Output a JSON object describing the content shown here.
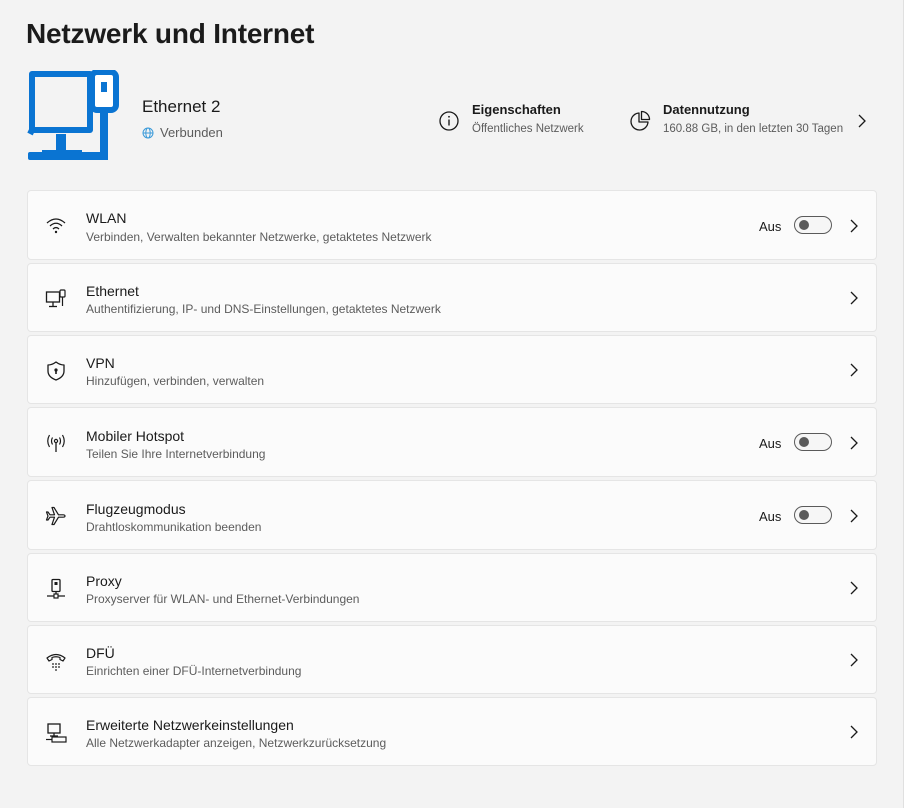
{
  "page": {
    "title": "Netzwerk und Internet"
  },
  "hero": {
    "name": "Ethernet 2",
    "status": "Verbunden",
    "properties": {
      "title": "Eigenschaften",
      "subtitle": "Öffentliches Netzwerk"
    },
    "usage": {
      "title": "Datennutzung",
      "subtitle": "160.88 GB, in den letzten 30 Tagen"
    }
  },
  "items": [
    {
      "title": "WLAN",
      "desc": "Verbinden, Verwalten bekannter Netzwerke, getaktetes Netzwerk",
      "state": "Aus",
      "icon": "wifi-icon"
    },
    {
      "title": "Ethernet",
      "desc": "Authentifizierung, IP- und DNS-Einstellungen, getaktetes Netzwerk",
      "icon": "ethernet-icon"
    },
    {
      "title": "VPN",
      "desc": "Hinzufügen, verbinden, verwalten",
      "icon": "shield-icon"
    },
    {
      "title": "Mobiler Hotspot",
      "desc": "Teilen Sie Ihre Internetverbindung",
      "state": "Aus",
      "icon": "hotspot-icon"
    },
    {
      "title": "Flugzeugmodus",
      "desc": "Drahtloskommunikation beenden",
      "state": "Aus",
      "icon": "airplane-icon"
    },
    {
      "title": "Proxy",
      "desc": "Proxyserver für WLAN- und Ethernet-Verbindungen",
      "icon": "proxy-icon"
    },
    {
      "title": "DFÜ",
      "desc": "Einrichten einer DFÜ-Internetverbindung",
      "icon": "dialup-icon"
    },
    {
      "title": "Erweiterte Netzwerkeinstellungen",
      "desc": "Alle Netzwerkadapter anzeigen, Netzwerkzurücksetzung",
      "icon": "advanced-network-icon"
    }
  ],
  "colors": {
    "accent": "#0067c0",
    "background": "#f3f3f3",
    "card": "#fbfbfb"
  }
}
